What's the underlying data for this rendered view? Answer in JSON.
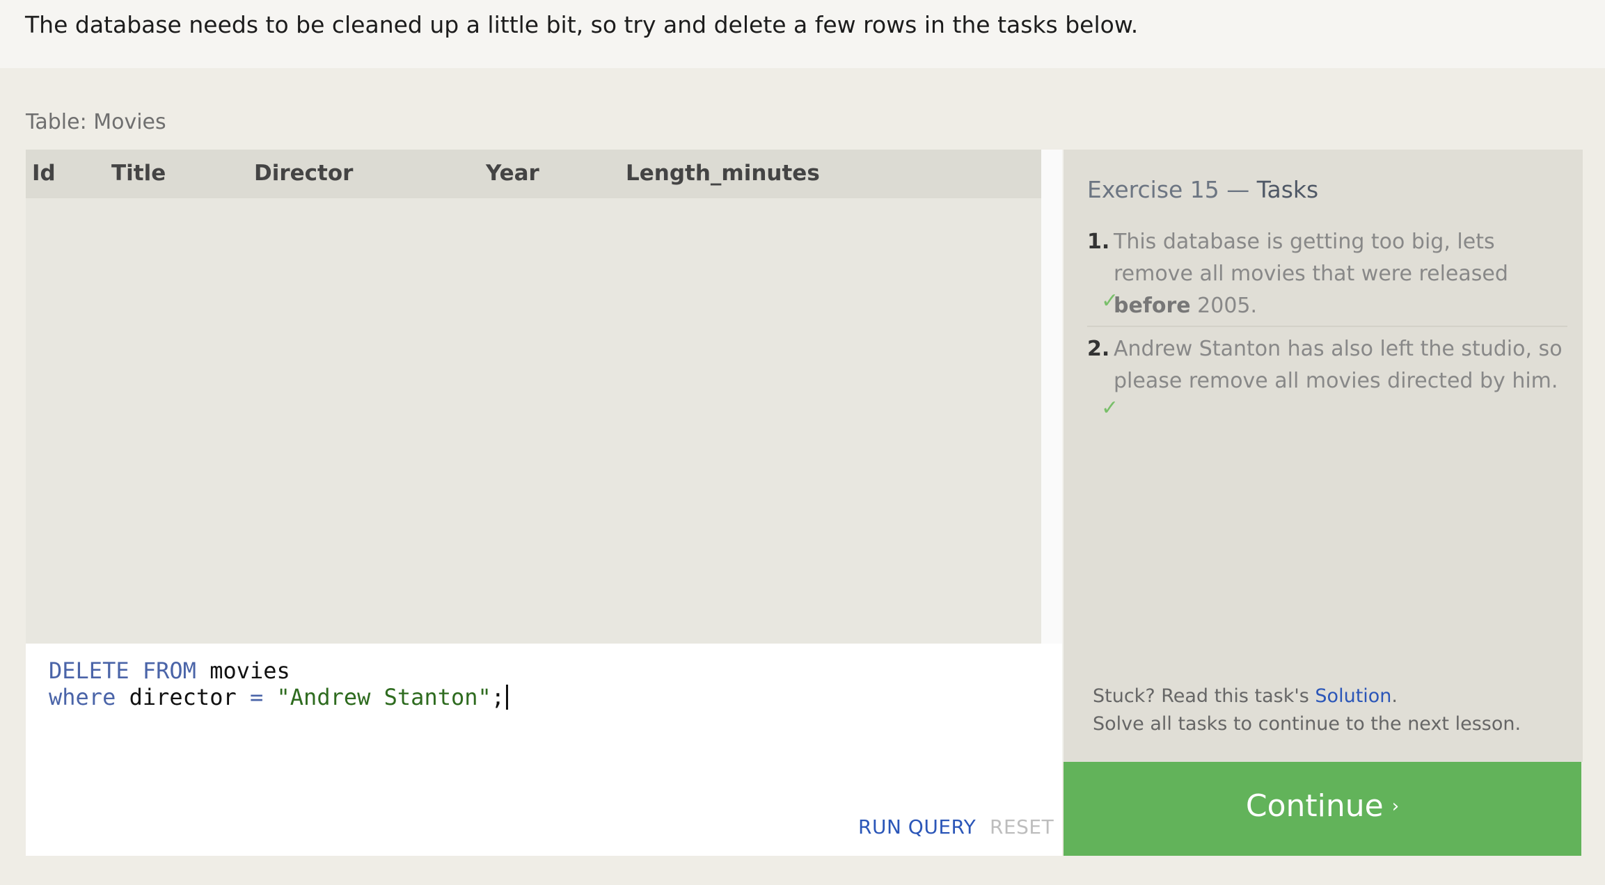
{
  "intro": {
    "text": "The database needs to be cleaned up a little bit, so try and delete a few rows in the tasks below."
  },
  "table": {
    "caption": "Table: Movies",
    "columns": [
      "Id",
      "Title",
      "Director",
      "Year",
      "Length_minutes"
    ],
    "rows": []
  },
  "editor": {
    "line1": {
      "kw": "DELETE FROM",
      "rest": " movies"
    },
    "line2": {
      "kw": "where",
      "mid": " director ",
      "op": "=",
      "str": "\"Andrew Stanton\"",
      "end": ";"
    },
    "run_label": "RUN QUERY",
    "reset_label": "RESET"
  },
  "exercise": {
    "title_prefix": "Exercise 15 — ",
    "title_strong": "Tasks",
    "tasks": [
      {
        "number": "1.",
        "text_before": "This database is getting too big, lets remove all movies that were released ",
        "bold": "before",
        "text_after": " 2005.",
        "check": "✓"
      },
      {
        "number": "2.",
        "text": "Andrew Stanton has also left the studio, so please remove all movies directed by him.",
        "check": "✓"
      }
    ],
    "stuck_prefix": "Stuck? Read this task's ",
    "stuck_link": "Solution",
    "stuck_suffix": ".",
    "solve_note": "Solve all tasks to continue to the next lesson.",
    "continue_label": "Continue",
    "continue_chevron": "›"
  },
  "colors": {
    "continue_bg": "#62b35a",
    "link": "#2b56b8",
    "check": "#79bf6a",
    "keyword": "#4a64a8",
    "string": "#2e6b1f"
  }
}
